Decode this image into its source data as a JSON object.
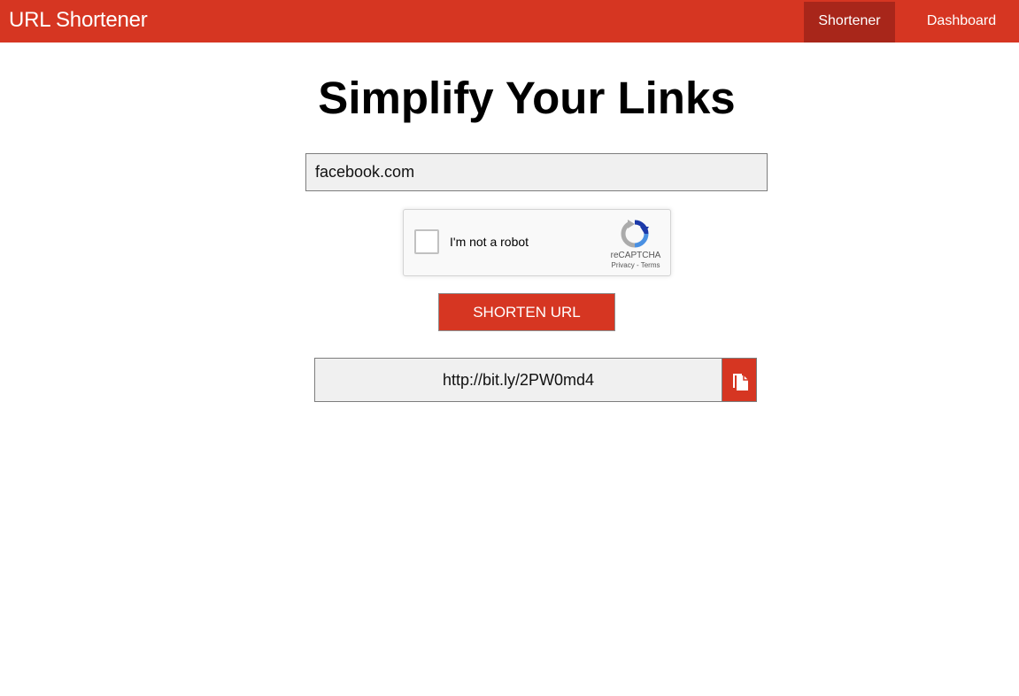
{
  "header": {
    "brand": "URL Shortener",
    "nav": [
      {
        "label": "Shortener",
        "active": true
      },
      {
        "label": "Dashboard",
        "active": false
      }
    ]
  },
  "main": {
    "headline": "Simplify Your Links",
    "url_input_value": "facebook.com",
    "captcha": {
      "label": "I'm not a robot",
      "brand": "reCAPTCHA",
      "links": "Privacy - Terms",
      "icon": "recaptcha-logo-icon"
    },
    "shorten_button_label": "SHORTEN URL",
    "short_url": "http://bit.ly/2PW0md4",
    "copy_icon": "copy-icon"
  },
  "colors": {
    "accent": "#d63622",
    "accent_dark": "#a8261a",
    "field_bg": "#f0f0f0"
  }
}
